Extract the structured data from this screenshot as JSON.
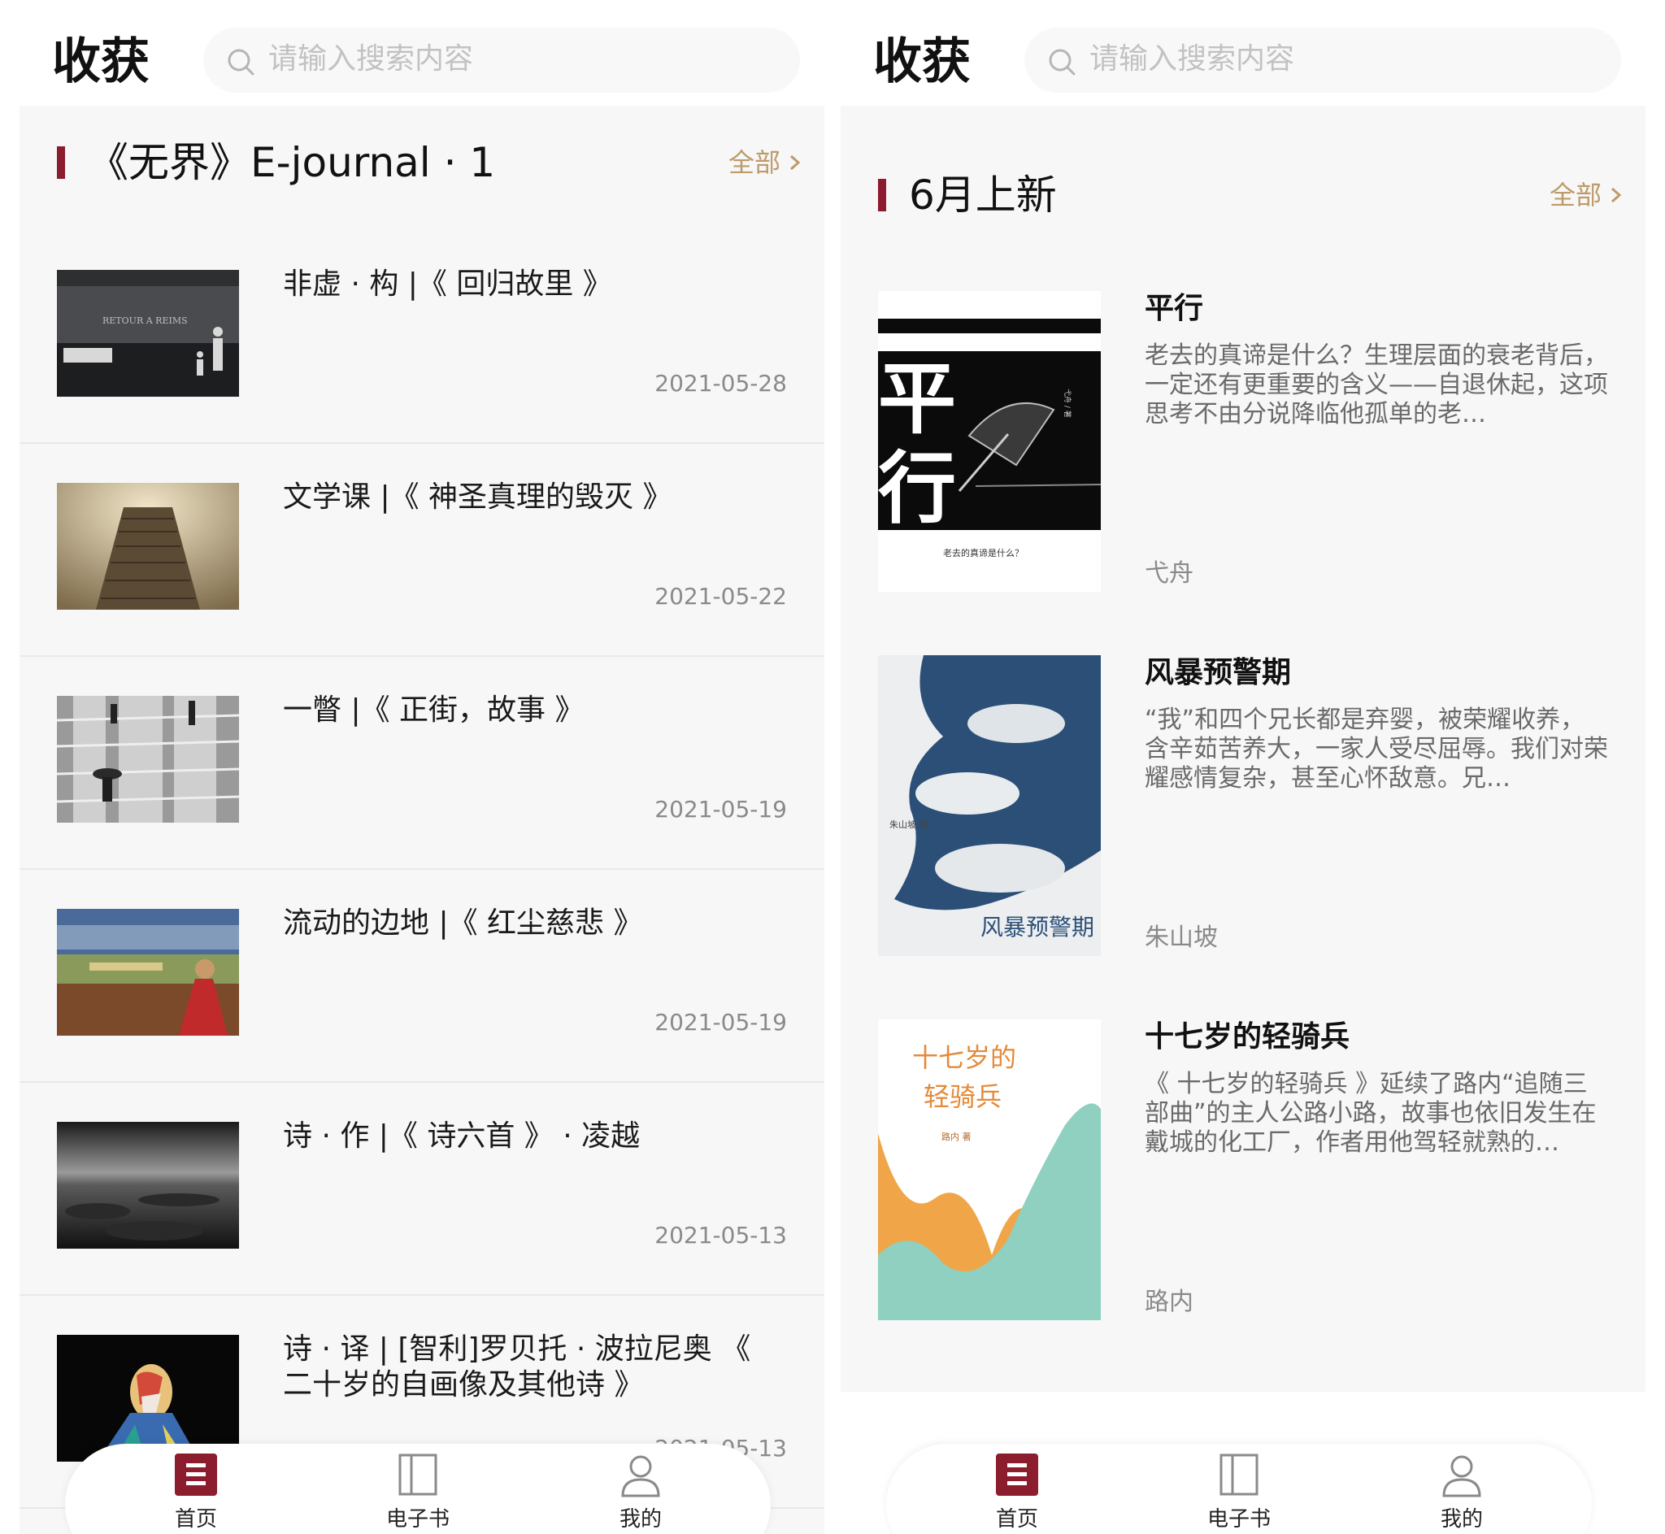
{
  "brand": {
    "logo_text": "收获"
  },
  "search": {
    "placeholder": "请输入搜索内容"
  },
  "colors": {
    "accent": "#8b1d2e",
    "more_link": "#bd9a6a",
    "panel_bg": "#f6f7f6"
  },
  "home": {
    "section_title": "《无界》E-journal · 1",
    "more_label": "全部",
    "articles": [
      {
        "title": "非虚 · 构 |《 回归故里 》",
        "date": "2021-05-28",
        "thumb_text": "RETOUR A REIMS"
      },
      {
        "title": "文学课 |《 神圣真理的毁灭 》",
        "date": "2021-05-22"
      },
      {
        "title": "一瞥 |《 正街，故事 》",
        "date": "2021-05-19"
      },
      {
        "title": "流动的边地 |《 红尘慈悲 》",
        "date": "2021-05-19"
      },
      {
        "title": "诗 · 作 |《 诗六首 》 · 凌越",
        "date": "2021-05-13"
      },
      {
        "title": "诗 · 译 | [智利]罗贝托 · 波拉尼奥 《 二十岁的自画像及其他诗 》",
        "date": "2021-05-13"
      }
    ]
  },
  "ebooks": {
    "section_title": "6月上新",
    "more_label": "全部",
    "books": [
      {
        "title": "平行",
        "desc": "老去的真谛是什么？生理层面的衰老背后，一定还有更重要的含义——自退休起，这项思考不由分说降临他孤单的老…",
        "author": "弋舟",
        "cover_big1": "平",
        "cover_big2": "行",
        "cover_sub": "老去的真谛是什么？",
        "cover_side": "弋舟 / 著"
      },
      {
        "title": "风暴预警期",
        "desc": "“我”和四个兄长都是弃婴，被荣耀收养，含辛茹苦养大，一家人受尽屈辱。我们对荣耀感情复杂，甚至心怀敌意。兄…",
        "author": "朱山坡",
        "cover_title": "风暴预警期",
        "cover_author": "朱山坡 著"
      },
      {
        "title": "十七岁的轻骑兵",
        "desc": "《 十七岁的轻骑兵 》延续了路内“追随三部曲”的主人公路小路，故事也依旧发生在戴城的化工厂，作者用他驾轻就熟的…",
        "author": "路内",
        "cover_line1": "十七岁的",
        "cover_line2": "轻骑兵",
        "cover_author": "路内 著"
      }
    ]
  },
  "tabs": [
    {
      "label": "首页",
      "icon": "home-icon",
      "active": true
    },
    {
      "label": "电子书",
      "icon": "book-icon",
      "active": false
    },
    {
      "label": "我的",
      "icon": "user-icon",
      "active": false
    }
  ]
}
